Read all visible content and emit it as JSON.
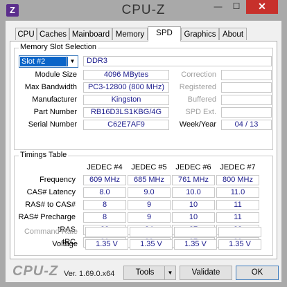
{
  "window": {
    "title": "CPU-Z",
    "icon_letter": "Z",
    "minimize_glyph": "—",
    "maximize_glyph": "☐",
    "close_glyph": "✕"
  },
  "tabs": [
    {
      "label": "CPU"
    },
    {
      "label": "Caches"
    },
    {
      "label": "Mainboard"
    },
    {
      "label": "Memory"
    },
    {
      "label": "SPD",
      "active": true
    },
    {
      "label": "Graphics"
    },
    {
      "label": "About"
    }
  ],
  "memory_slot": {
    "group_title": "Memory Slot Selection",
    "slot_selected": "Slot #2",
    "memory_type": "DDR3",
    "module_size_label": "Module Size",
    "module_size": "4096 MBytes",
    "max_bandwidth_label": "Max Bandwidth",
    "max_bandwidth": "PC3-12800 (800 MHz)",
    "manufacturer_label": "Manufacturer",
    "manufacturer": "Kingston",
    "part_number_label": "Part Number",
    "part_number": "RB16D3LS1KBG/4G",
    "serial_number_label": "Serial Number",
    "serial_number": "C62E7AF9",
    "correction_label": "Correction",
    "registered_label": "Registered",
    "buffered_label": "Buffered",
    "spd_ext_label": "SPD Ext.",
    "week_year_label": "Week/Year",
    "week_year": "04 / 13"
  },
  "timings": {
    "group_title": "Timings Table",
    "columns": [
      "JEDEC #4",
      "JEDEC #5",
      "JEDEC #6",
      "JEDEC #7"
    ],
    "rows": [
      {
        "label": "Frequency",
        "values": [
          "609 MHz",
          "685 MHz",
          "761 MHz",
          "800 MHz"
        ]
      },
      {
        "label": "CAS# Latency",
        "values": [
          "8.0",
          "9.0",
          "10.0",
          "11.0"
        ]
      },
      {
        "label": "RAS# to CAS#",
        "values": [
          "8",
          "9",
          "10",
          "11"
        ]
      },
      {
        "label": "RAS# Precharge",
        "values": [
          "8",
          "9",
          "10",
          "11"
        ]
      },
      {
        "label": "tRAS",
        "values": [
          "22",
          "24",
          "27",
          "28"
        ]
      },
      {
        "label": "tRC",
        "values": [
          "30",
          "33",
          "37",
          "39"
        ]
      },
      {
        "label": "Command Rate",
        "dim": true,
        "values": [
          "",
          "",
          "",
          ""
        ]
      },
      {
        "label": "Voltage",
        "values": [
          "1.35 V",
          "1.35 V",
          "1.35 V",
          "1.35 V"
        ]
      }
    ]
  },
  "footer": {
    "logo": "CPU-Z",
    "version": "Ver. 1.69.0.x64",
    "tools_label": "Tools",
    "validate_label": "Validate",
    "ok_label": "OK"
  }
}
